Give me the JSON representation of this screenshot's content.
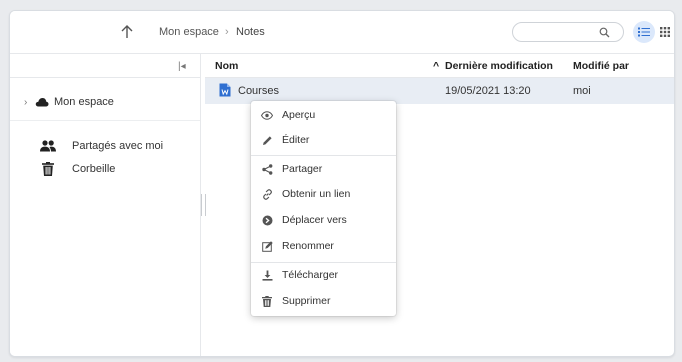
{
  "breadcrumb": {
    "root": "Mon espace",
    "separator": "›",
    "current": "Notes"
  },
  "search": {
    "value": "",
    "placeholder": ""
  },
  "sidebar": {
    "collapse_glyph": "|◂",
    "tree_root": {
      "label": "Mon espace",
      "icon": "cloud-icon"
    },
    "links": [
      {
        "label": "Partagés avec moi",
        "icon": "people-icon"
      },
      {
        "label": "Corbeille",
        "icon": "trash-icon"
      }
    ]
  },
  "table": {
    "columns": [
      "Nom",
      "Dernière modification",
      "Modifié par"
    ],
    "rows": [
      {
        "name": "Courses",
        "modified": "19/05/2021 13:20",
        "modified_by": "moi"
      }
    ]
  },
  "context_menu": {
    "items": [
      {
        "label": "Aperçu",
        "icon": "eye-icon"
      },
      {
        "label": "Éditer",
        "icon": "pencil-icon"
      },
      {
        "label": "Partager",
        "icon": "share-icon"
      },
      {
        "label": "Obtenir un lien",
        "icon": "link-icon"
      },
      {
        "label": "Déplacer vers",
        "icon": "move-icon"
      },
      {
        "label": "Renommer",
        "icon": "rename-icon"
      },
      {
        "label": "Télécharger",
        "icon": "download-icon"
      },
      {
        "label": "Supprimer",
        "icon": "delete-icon"
      }
    ]
  },
  "colors": {
    "accent": "#2f6fd1",
    "selected_row": "#e8edf4",
    "active_view": "#dbe8fb"
  }
}
